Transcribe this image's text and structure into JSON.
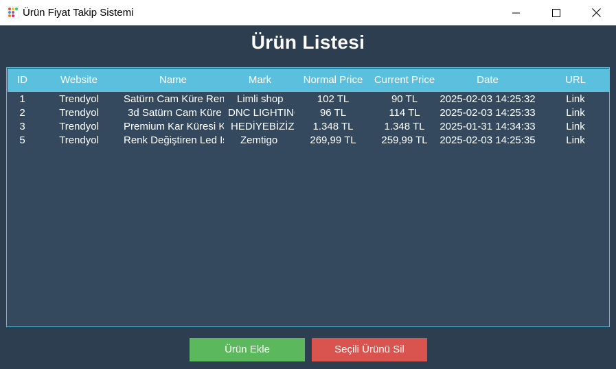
{
  "window": {
    "title": "Ürün Fiyat Takip Sistemi"
  },
  "heading": "Ürün Listesi",
  "table": {
    "header_color": "#5bc0de",
    "columns": [
      "ID",
      "Website",
      "Name",
      "Mark",
      "Normal Price",
      "Current Price",
      "Date",
      "URL"
    ],
    "rows": [
      {
        "id": "1",
        "website": "Trendyol",
        "name": "Satürn Cam Küre Renç",
        "mark": "Limli shop",
        "normal_price": "102 TL",
        "current_price": "90 TL",
        "date": "2025-02-03 14:25:32",
        "url": "Link"
      },
      {
        "id": "2",
        "website": "Trendyol",
        "name": "3d Satürn Cam Küre",
        "mark": "DNC LIGHTINC",
        "normal_price": "96 TL",
        "current_price": "114 TL",
        "date": "2025-02-03 14:25:33",
        "url": "Link"
      },
      {
        "id": "3",
        "website": "Trendyol",
        "name": "Premium Kar Küresi Ki",
        "mark": "HEDİYEBİZİZ",
        "normal_price": "1.348 TL",
        "current_price": "1.348 TL",
        "date": "2025-01-31 14:34:33",
        "url": "Link"
      },
      {
        "id": "5",
        "website": "Trendyol",
        "name": "Renk Değiştiren Led Iş",
        "mark": "Zemtigo",
        "normal_price": "269,99 TL",
        "current_price": "259,99 TL",
        "date": "2025-02-03 14:25:35",
        "url": "Link"
      }
    ]
  },
  "buttons": {
    "add": {
      "label": "Ürün Ekle",
      "color": "#5cb85c"
    },
    "delete": {
      "label": "Seçili Ürünü Sil",
      "color": "#d9534f"
    }
  },
  "colors": {
    "background": "#2d3e50",
    "table_background": "#34495e"
  }
}
